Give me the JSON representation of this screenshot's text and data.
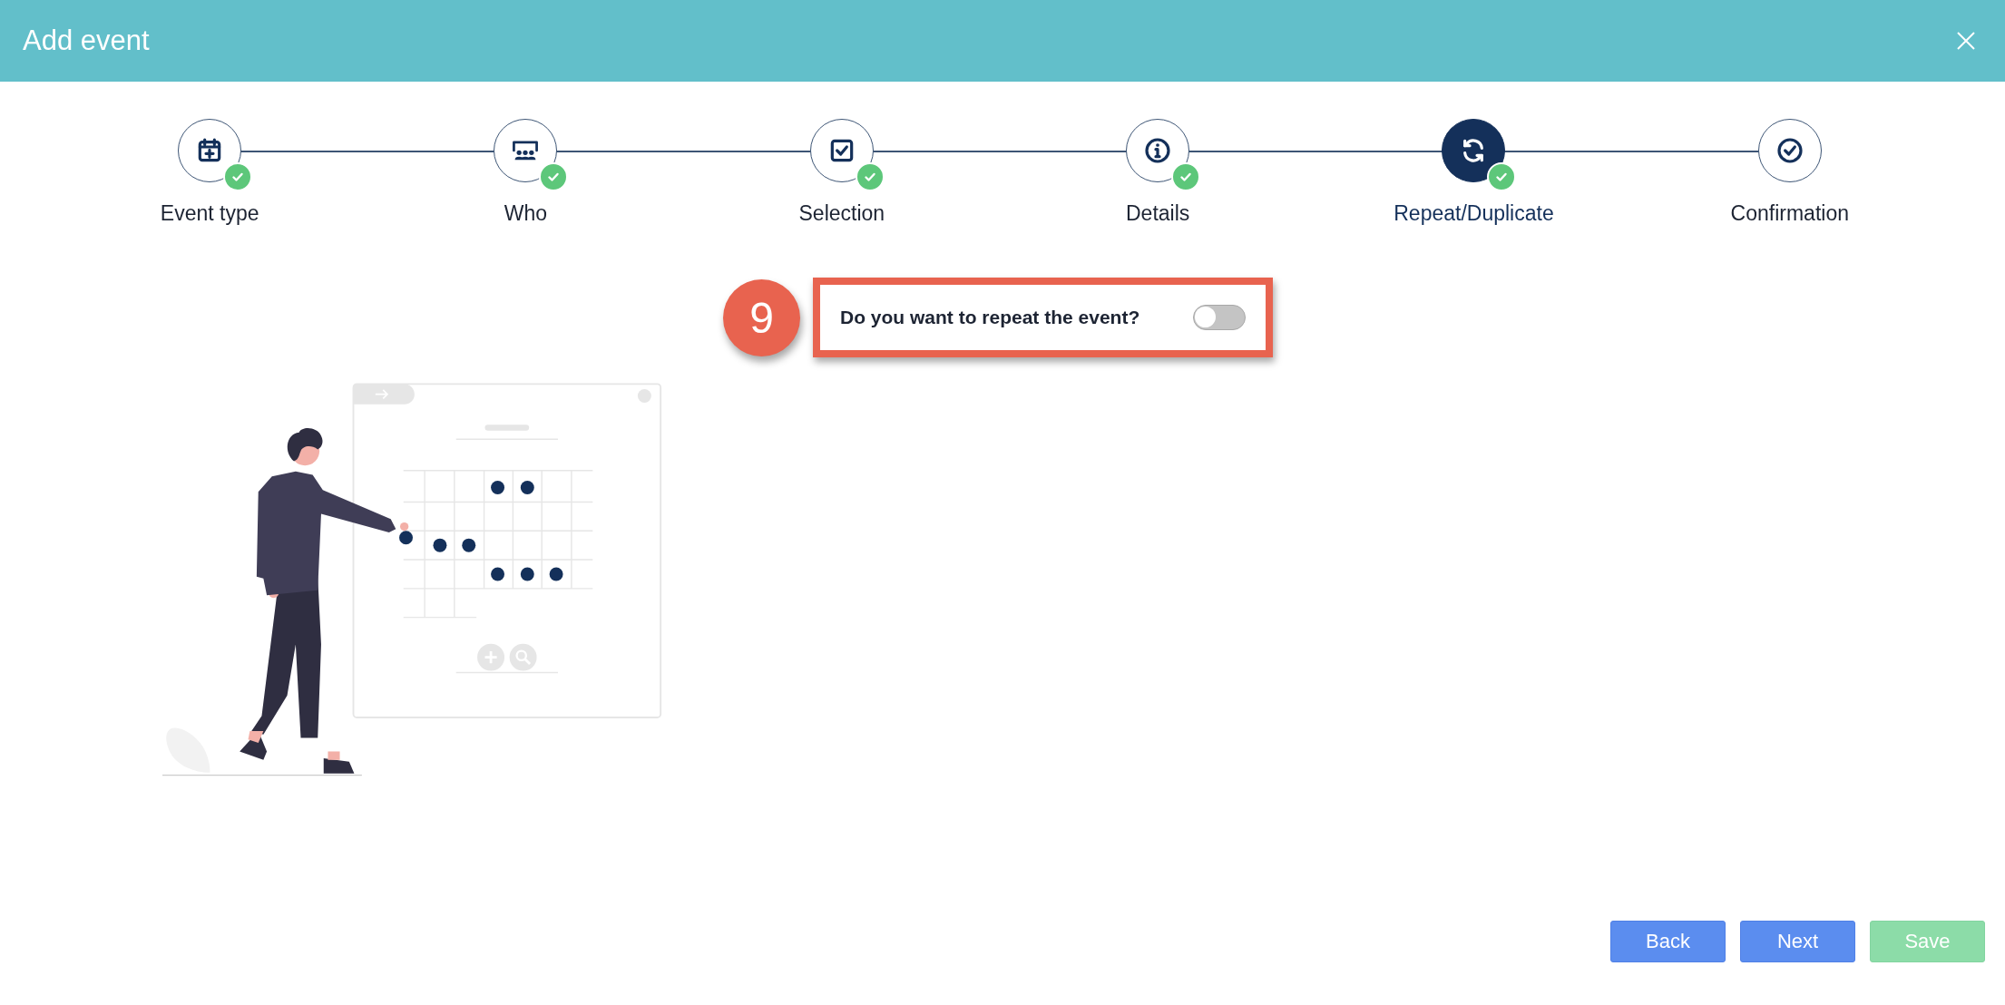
{
  "window": {
    "title": "Add event"
  },
  "steps": [
    {
      "label": "Event type",
      "kind": "calendar",
      "completed": true,
      "selected": false
    },
    {
      "label": "Who",
      "kind": "people",
      "completed": true,
      "selected": false
    },
    {
      "label": "Selection",
      "kind": "checkbox",
      "completed": true,
      "selected": false
    },
    {
      "label": "Details",
      "kind": "info",
      "completed": true,
      "selected": false
    },
    {
      "label": "Repeat/Duplicate",
      "kind": "repeat",
      "completed": true,
      "selected": true
    },
    {
      "label": "Confirmation",
      "kind": "check",
      "completed": false,
      "selected": false
    }
  ],
  "annotation": {
    "number": "9"
  },
  "question": {
    "label": "Do you want to repeat the event?",
    "on": false
  },
  "buttons": [
    {
      "label": "Back",
      "kind": "primary",
      "disabled": false
    },
    {
      "label": "Next",
      "kind": "primary",
      "disabled": false
    },
    {
      "label": "Save",
      "kind": "success",
      "disabled": true
    }
  ]
}
